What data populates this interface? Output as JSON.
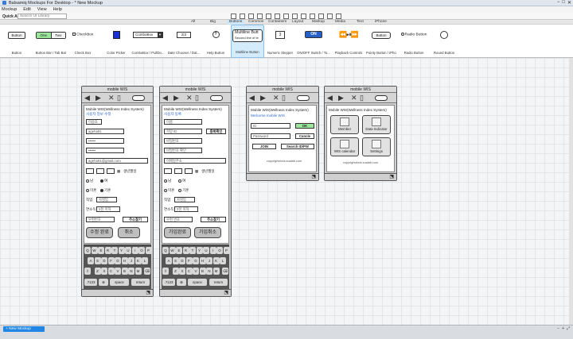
{
  "window": {
    "title": "Balsamiq Mockups For Desktop - * New Mockup",
    "controls": [
      "−",
      "□",
      "✕"
    ]
  },
  "menu": [
    "Mockup",
    "Edit",
    "View",
    "Help"
  ],
  "quick_add": {
    "label": "Quick Add",
    "placeholder": "Search UI Library"
  },
  "categories": {
    "all": "All",
    "big": "Big",
    "buttons": "Buttons",
    "common": "Common",
    "containers": "Containers",
    "layout": "Layout",
    "markup": "Markup",
    "media": "Media",
    "text": "Text",
    "iphone": "iPhone"
  },
  "library": {
    "button": {
      "label": "Button",
      "preview": "Button"
    },
    "buttonbar": {
      "label": "Button Bar / Tab Bar",
      "one": "One",
      "two": "Two"
    },
    "checkbox": {
      "label": "Check Box",
      "preview": "Checkbox"
    },
    "colorpicker": {
      "label": "Color Picker"
    },
    "combobox": {
      "label": "ComboBox / PullDo...",
      "preview": "ComboBox"
    },
    "datechooser": {
      "label": "Date Chooser / Dat...",
      "preview": "2|3"
    },
    "help": {
      "label": "Help Button",
      "preview": "?"
    },
    "multiline": {
      "label": "Multiline Button",
      "line1": "Multiline Butt",
      "line2": "Second line of te"
    },
    "stepper": {
      "label": "Numeric Stepper",
      "preview": "3"
    },
    "onoff": {
      "label": "ON/OFF Switch / To...",
      "preview": "ON"
    },
    "playback": {
      "label": "Playback Controls"
    },
    "pointy": {
      "label": "Pointy Button / iPho...",
      "preview": "Button"
    },
    "radio": {
      "label": "Radio Button",
      "preview": "Radio Button"
    },
    "round": {
      "label": "Round Button"
    }
  },
  "phones": {
    "title": "mobile WIS",
    "nav_icons": [
      "◀",
      "▶",
      "✕",
      "▯"
    ],
    "subtitle": "Mobile WIS(Wellness Index System)",
    "keys_row1": [
      "Q",
      "W",
      "E",
      "R",
      "T",
      "Y",
      "U",
      "I",
      "O",
      "P"
    ],
    "keys_row2": [
      "A",
      "S",
      "D",
      "F",
      "G",
      "H",
      "J",
      "K",
      "L"
    ],
    "keys_row3": [
      "⇧",
      "Z",
      "X",
      "C",
      "V",
      "B",
      "N",
      "M",
      "⌫"
    ],
    "key_123": ".?123",
    "key_space": "space",
    "key_return": "return",
    "p1": {
      "heading": "사용자 정보 수정",
      "fields": [
        "이승호",
        "ageha81",
        "••••••",
        "••••••",
        "ageha81@gmail.com"
      ],
      "birth": "생년월일",
      "gender": [
        "남",
        "여"
      ],
      "marital": [
        "미혼",
        "기혼"
      ],
      "job_label": "직업",
      "job_value": "자영업",
      "cause_label": "연소득",
      "cause_value": "2천 이하",
      "zip_ph": "우편번호",
      "zip_btn": "주소찾기",
      "btn_ok": "수정 완료",
      "btn_cancel": "취소"
    },
    "p2": {
      "heading": "사용자 등록",
      "fields": [
        "이름",
        "희망 ID",
        "비밀번호",
        "비밀번호 확인",
        "이메일주소"
      ],
      "dup_btn": "중복확인",
      "birth": "생년월일",
      "gender": [
        "남",
        "여"
      ],
      "marital": [
        "미혼",
        "기혼"
      ],
      "job_label": "직업",
      "job_value": "자영업",
      "cause_label": "연소득",
      "cause_value": "2천 이하",
      "zip_ph": "우편 번호",
      "zip_btn": "주소찾기",
      "btn_ok": "가입완료",
      "btn_cancel": "가입취소"
    },
    "p3": {
      "welcome": "Welcome mobile WIS",
      "id_ph": "ID",
      "pw_ph": "Password",
      "ok": "OK",
      "cancel": "Cancle",
      "join": "JOIN",
      "search": "Search ID/PW",
      "copyright": "copyrightzlwis.sualab.com"
    },
    "p4": {
      "tiles": [
        "Member",
        "Data Indicator",
        "WIS calendar",
        "Settings"
      ],
      "copyright": "copyrightzlwis.sualab.com"
    }
  },
  "status": {
    "new_mockup": "+ New Mockup",
    "zoom": [
      "−",
      "+",
      "⤢"
    ]
  }
}
